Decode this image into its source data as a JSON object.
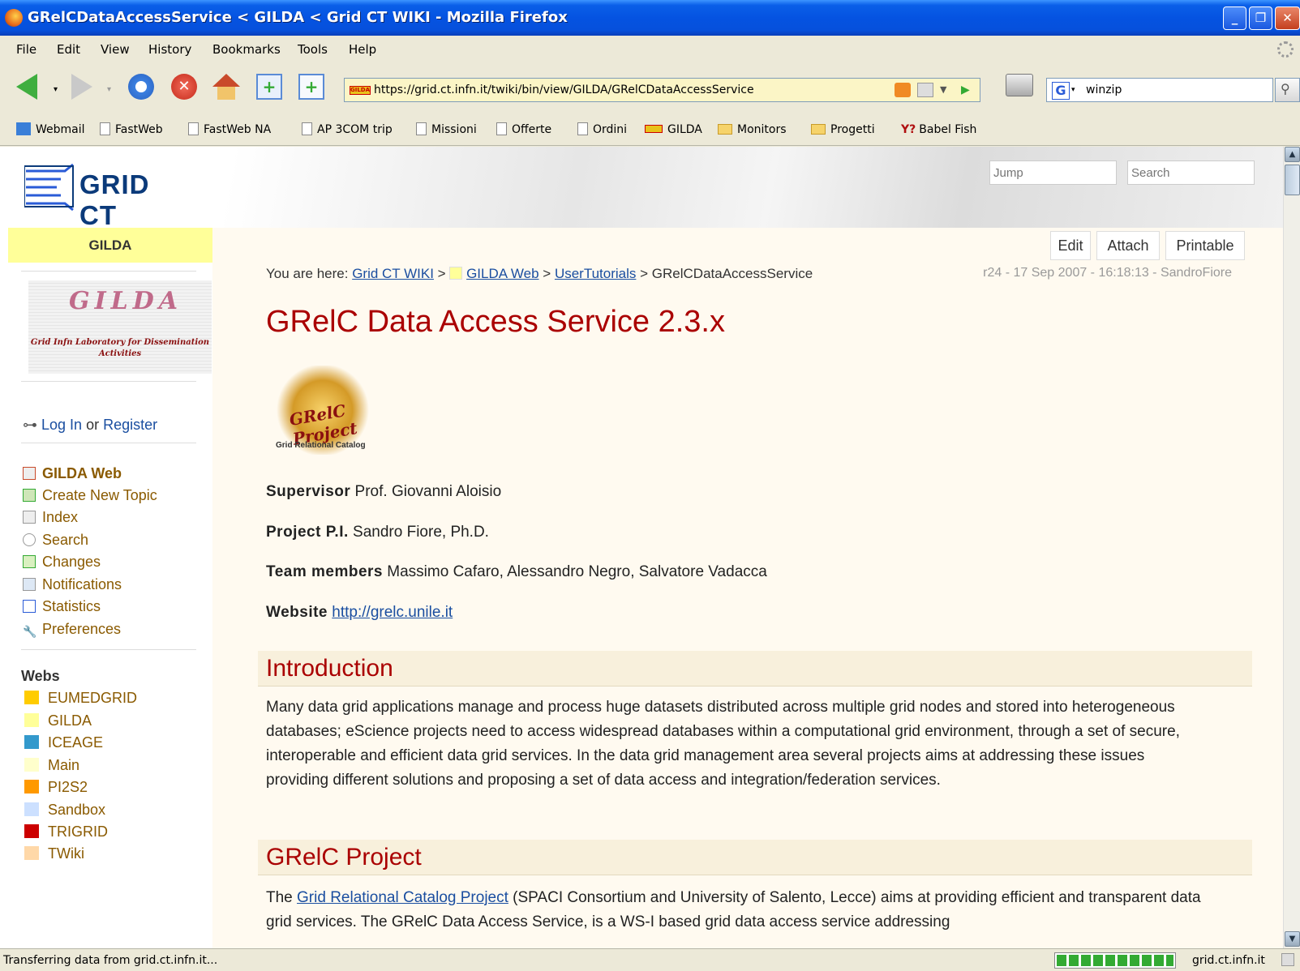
{
  "window": {
    "title": "GRelCDataAccessService < GILDA < Grid CT WIKI - Mozilla Firefox"
  },
  "menu": [
    "File",
    "Edit",
    "View",
    "History",
    "Bookmarks",
    "Tools",
    "Help"
  ],
  "nav": {
    "url": "https://grid.ct.infn.it/twiki/bin/view/GILDA/GRelCDataAccessService",
    "search_value": "winzip",
    "favicon_text": "GILDA"
  },
  "bookmarks": [
    "Webmail",
    "FastWeb",
    "FastWeb NA",
    "AP 3COM trip",
    "Missioni",
    "Offerte",
    "Ordini",
    "GILDA",
    "Monitors",
    "Progetti",
    "Babel Fish"
  ],
  "header": {
    "logo_text": "GRID CT",
    "jump_placeholder": "Jump",
    "search_placeholder": "Search"
  },
  "sidebar": {
    "web_title": "GILDA",
    "gilda_logo_big": "GILDA",
    "gilda_logo_sub": "Grid Infn Laboratory for Dissemination Activities",
    "login": "Log In",
    "or": "or",
    "register": "Register",
    "nav": [
      {
        "label": "GILDA Web",
        "icon": "home-icon"
      },
      {
        "label": "Create New Topic",
        "icon": "new-topic-icon"
      },
      {
        "label": "Index",
        "icon": "index-icon"
      },
      {
        "label": "Search",
        "icon": "search-icon"
      },
      {
        "label": "Changes",
        "icon": "changes-icon"
      },
      {
        "label": "Notifications",
        "icon": "notify-icon"
      },
      {
        "label": "Statistics",
        "icon": "stats-icon"
      },
      {
        "label": "Preferences",
        "icon": "wrench-icon"
      }
    ],
    "webs_title": "Webs",
    "webs": [
      {
        "label": "EUMEDGRID",
        "color": "#ffcc00"
      },
      {
        "label": "GILDA",
        "color": "#ffff99"
      },
      {
        "label": "ICEAGE",
        "color": "#3399cc"
      },
      {
        "label": "Main",
        "color": "#ffffcc"
      },
      {
        "label": "PI2S2",
        "color": "#ff9900"
      },
      {
        "label": "Sandbox",
        "color": "#cce0ff"
      },
      {
        "label": "TRIGRID",
        "color": "#cc0000"
      },
      {
        "label": "TWiki",
        "color": "#ffd8a8"
      }
    ]
  },
  "page": {
    "buttons": {
      "edit": "Edit",
      "attach": "Attach",
      "printable": "Printable"
    },
    "breadcrumb": {
      "prefix": "You are here:",
      "wiki": "Grid CT WIKI",
      "sep": ">",
      "web": "GILDA Web",
      "parent": "UserTutorials",
      "current": "GRelCDataAccessService"
    },
    "revision": "r24 - 17 Sep 2007 - 16:18:13 - SandroFiore",
    "title": "GRelC Data Access Service 2.3.x",
    "project_logo": {
      "name": "GRelC Project",
      "subtitle": "Grid Relational Catalog"
    },
    "supervisor_label": "Supervisor",
    "supervisor": "Prof. Giovanni Aloisio",
    "pi_label": "Project P.I.",
    "pi": "Sandro Fiore, Ph.D.",
    "team_label": "Team members",
    "team": "Massimo Cafaro, Alessandro Negro, Salvatore Vadacca",
    "website_label": "Website",
    "website": "http://grelc.unile.it",
    "intro_heading": "Introduction",
    "intro_text": "Many data grid applications manage and process huge datasets distributed across multiple grid nodes and stored into heterogeneous databases; eScience projects need to access widespread databases within a computational grid environment, through a set of secure, interoperable and efficient data grid services. In the data grid management area several projects aims at addressing these issues providing different solutions and proposing a set of data access and integration/federation services.",
    "project_heading": "GRelC Project",
    "project_text_prefix": "The",
    "project_link": "Grid Relational Catalog Project",
    "project_text": "(SPACI Consortium and University of Salento, Lecce) aims at providing efficient and transparent data grid services. The GRelC Data Access Service, is a WS-I based grid data access service addressing"
  },
  "status": {
    "message": "Transferring data from grid.ct.infn.it...",
    "host": "grid.ct.infn.it",
    "progress": 1.0
  }
}
